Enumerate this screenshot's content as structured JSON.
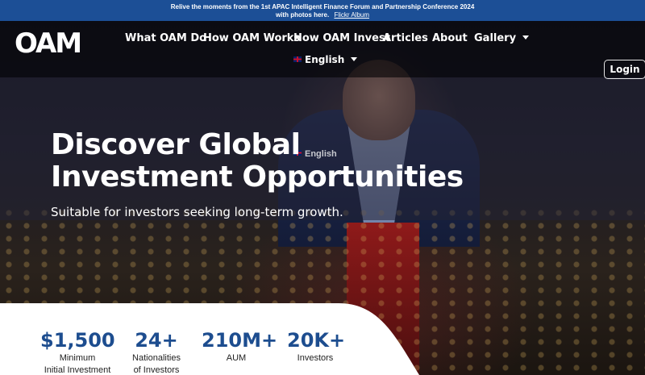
{
  "announcement": {
    "line1": "Relive the moments from the 1st APAC Intelligent Finance Forum and Partnership Conference 2024",
    "line2": "with photos here.",
    "link": "Flickr Album"
  },
  "nav": {
    "logo": "OAM",
    "items": [
      {
        "label": "What OAM Do"
      },
      {
        "label": "How OAM Works"
      },
      {
        "label": "How OAM Invest"
      },
      {
        "label": "Articles"
      },
      {
        "label": "About"
      },
      {
        "label": "Gallery"
      }
    ],
    "language": "English",
    "login": "Login"
  },
  "hero": {
    "ghost_language": "English",
    "title_line1": "Discover Global",
    "title_line2": "Investment Opportunities",
    "subtitle": "Suitable for investors seeking long-term growth."
  },
  "stats": [
    {
      "value": "$1,500",
      "label1": "Minimum",
      "label2": "Initial Investment"
    },
    {
      "value": "24+",
      "label1": "Nationalities",
      "label2": "of Investors"
    },
    {
      "value": "210M+",
      "label1": "AUM",
      "label2": ""
    },
    {
      "value": "20K+",
      "label1": "Investors",
      "label2": ""
    }
  ],
  "colors": {
    "announcement_bg": "#1c4f96",
    "stat_value": "#1d4d8f"
  },
  "icons": {
    "gallery_dropdown": "chevron-down-icon",
    "language_dropdown": "chevron-down-icon",
    "language_flag": "uk-flag-icon"
  }
}
